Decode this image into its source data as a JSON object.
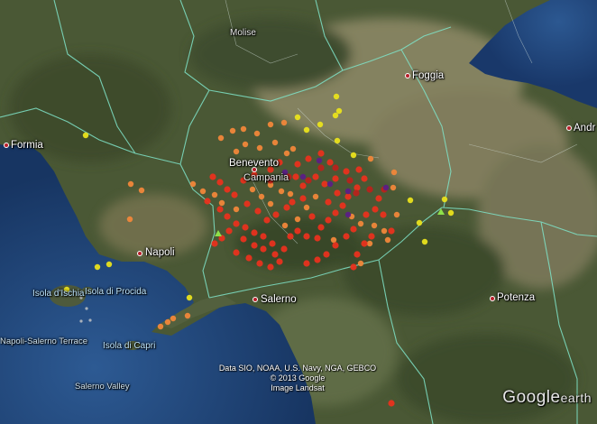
{
  "labels": {
    "molise": "Molise",
    "foggia": "Foggia",
    "formia": "Formia",
    "andria": "Andr",
    "benevento": "Benevento",
    "campania": "Campania",
    "napoli": "Napoli",
    "salerno": "Salerno",
    "potenza": "Potenza",
    "ischia": "Isola d'Ischia",
    "procida": "Isola di Procida",
    "capri": "Isola di Capri",
    "terrace": "Napoli-Salerno Terrace",
    "valley": "Salerno Valley"
  },
  "credits": {
    "line1": "Data SIO, NOAA, U.S. Navy, NGA, GEBCO",
    "line2": "© 2013 Google",
    "line3": "Image Landsat"
  },
  "logo": {
    "main": "Google",
    "sub": "earth"
  },
  "colors": {
    "sea": "#22467a",
    "land": "#4d5b37",
    "border": "#7fe3c8",
    "red": "#e8321e",
    "orange": "#f0873a",
    "yellow": "#e9e21c",
    "purple": "#5b1f86"
  },
  "icons": [
    "earthquake-marker-icon",
    "triangle-marker-icon",
    "city-marker-icon"
  ]
}
